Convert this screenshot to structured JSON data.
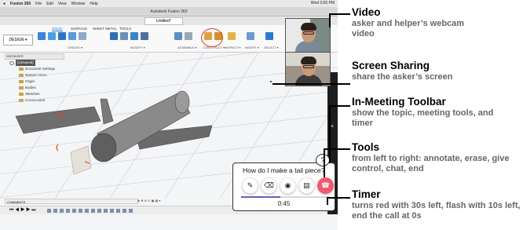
{
  "screenshot": {
    "mac_menu": [
      "Fusion 360",
      "File",
      "Edit",
      "View",
      "Window",
      "Help"
    ],
    "mac_clock": "Wed 3:56 PM",
    "window_title": "Autodesk Fusion 360",
    "doc_tab": "Untitled*",
    "workspace_button": "DESIGN ▾",
    "ribbon_tabs": [
      "SOLID",
      "SURFACE",
      "SHEET METAL",
      "TOOLS"
    ],
    "ribbon_groups": [
      "CREATE ▾",
      "MODIFY ▾",
      "ASSEMBLE ▾",
      "CONSTRUCT ▾",
      "INSPECT ▾",
      "INSERT ▾",
      "SELECT ▾"
    ],
    "browser": {
      "header": "BROWSER",
      "root": "(Unsaved)",
      "items": [
        "Document Settings",
        "Named Views",
        "Origin",
        "Bodies",
        "Sketches",
        "Construction"
      ]
    },
    "comments_label": "COMMENTS"
  },
  "call": {
    "question": "How do I make a tail piece?",
    "question_icon": "?",
    "tools": [
      {
        "name": "annotate",
        "icon": "✎"
      },
      {
        "name": "erase",
        "icon": "⌫"
      },
      {
        "name": "give-control",
        "icon": "◉"
      },
      {
        "name": "chat",
        "icon": "▤"
      },
      {
        "name": "end",
        "icon": "☎"
      }
    ],
    "timer": "0:45",
    "timer_progress": 0.45,
    "accent": "#6b5db0",
    "end_color": "#f05a6e"
  },
  "annotations": [
    {
      "title": "Video",
      "desc": "asker and helper’s webcam video"
    },
    {
      "title": "Screen Sharing",
      "desc": "share the asker’s screen"
    },
    {
      "title": "In-Meeting Toolbar",
      "desc": "show the topic, meeting tools, and timer"
    },
    {
      "title": "Tools",
      "desc": "from left to right: annotate, erase, give control, chat, end"
    },
    {
      "title": "Timer",
      "desc": "turns red with 30s left, flash with 10s left, end the call at 0s"
    }
  ]
}
